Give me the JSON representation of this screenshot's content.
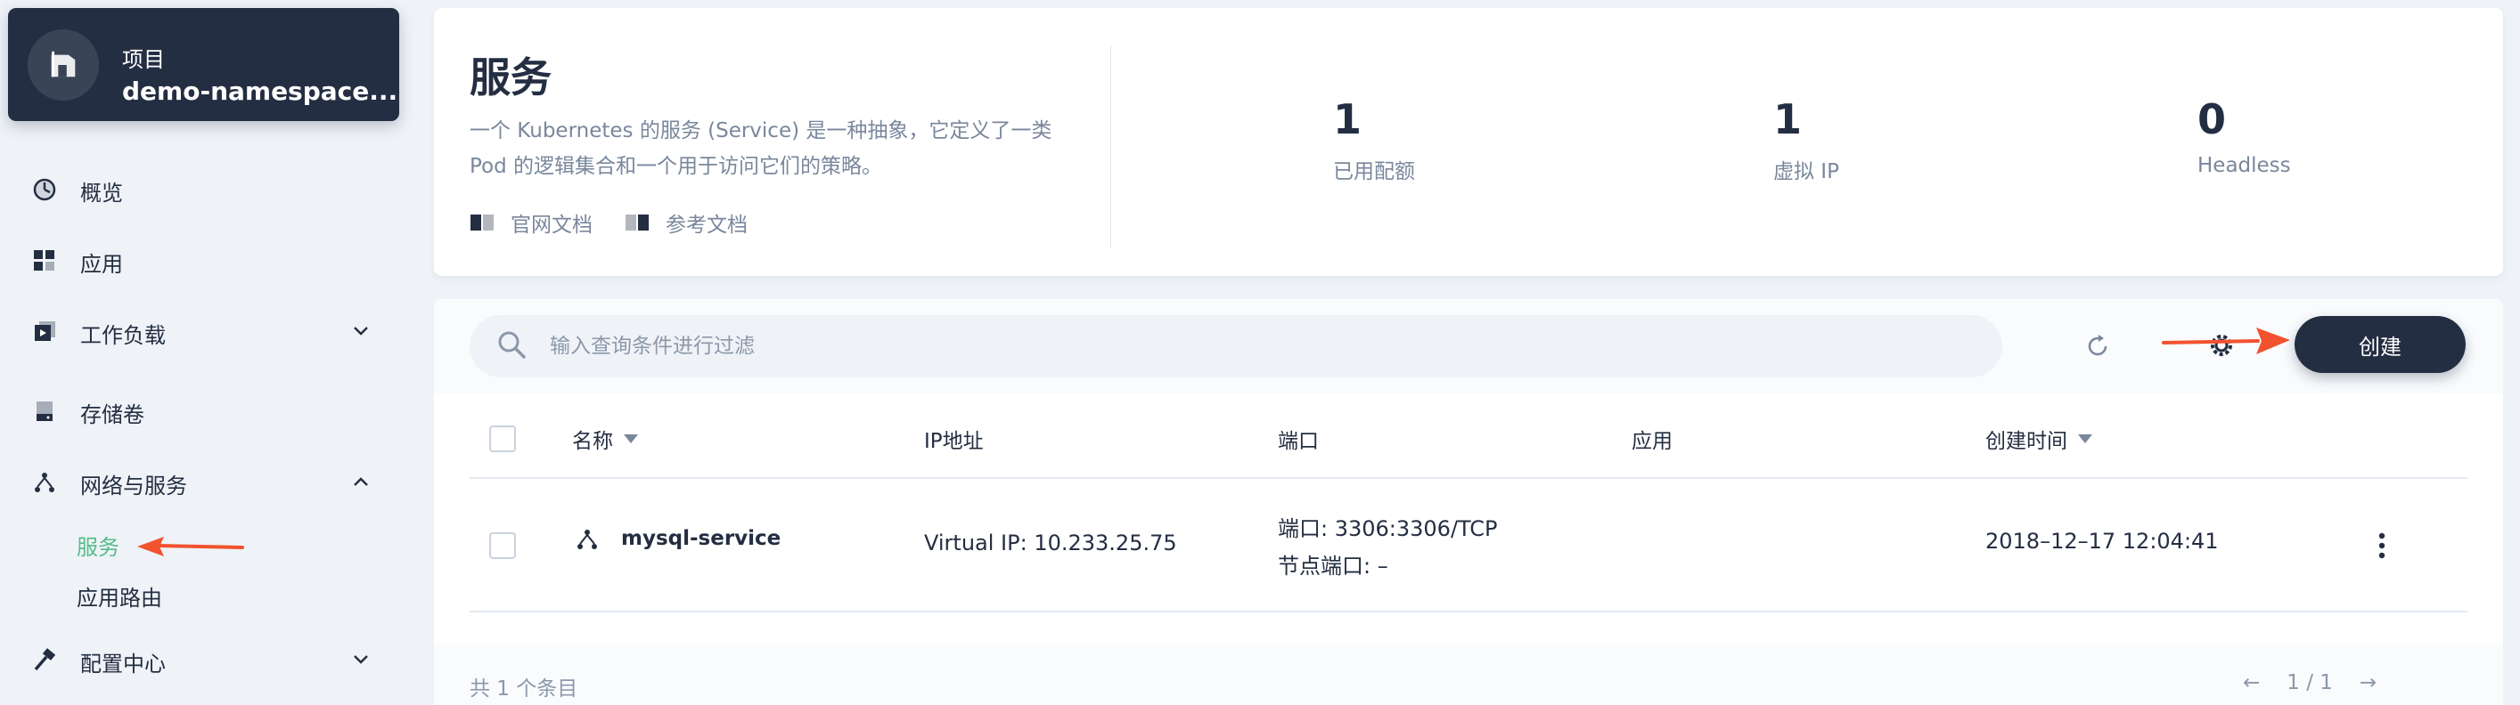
{
  "sidebar": {
    "project": {
      "type_label": "项目",
      "name": "demo-namespace..."
    },
    "items": [
      {
        "label": "概览"
      },
      {
        "label": "应用"
      },
      {
        "label": "工作负载"
      },
      {
        "label": "存储卷"
      },
      {
        "label": "网络与服务"
      },
      {
        "label": "配置中心"
      }
    ],
    "subitems": [
      {
        "label": "服务",
        "active": true
      },
      {
        "label": "应用路由"
      }
    ]
  },
  "header": {
    "title": "服务",
    "description": "一个 Kubernetes 的服务 (Service) 是一种抽象，它定义了一类 Pod 的逻辑集合和一个用于访问它们的策略。",
    "links": {
      "official_docs": "官网文档",
      "reference_docs": "参考文档"
    },
    "stats": [
      {
        "value": "1",
        "label": "已用配额"
      },
      {
        "value": "1",
        "label": "虚拟 IP"
      },
      {
        "value": "0",
        "label": "Headless"
      }
    ]
  },
  "toolbar": {
    "search_placeholder": "输入查询条件进行过滤",
    "create_label": "创建"
  },
  "table": {
    "columns": {
      "name": "名称",
      "ip": "IP地址",
      "port": "端口",
      "app": "应用",
      "created": "创建时间"
    },
    "rows": [
      {
        "name": "mysql-service",
        "ip": "Virtual IP: 10.233.25.75",
        "port": "端口: 3306:3306/TCP",
        "node_port": "节点端口: –",
        "app": "",
        "created": "2018–12–17 12:04:41"
      }
    ]
  },
  "footer": {
    "total": "共 1 个条目",
    "prev": "←",
    "page": "1 / 1",
    "next": "→"
  },
  "colors": {
    "primary": "#242e42",
    "active_green": "#55bc8a",
    "annotation_arrow": "#f2522e",
    "muted_text": "#79879c"
  }
}
